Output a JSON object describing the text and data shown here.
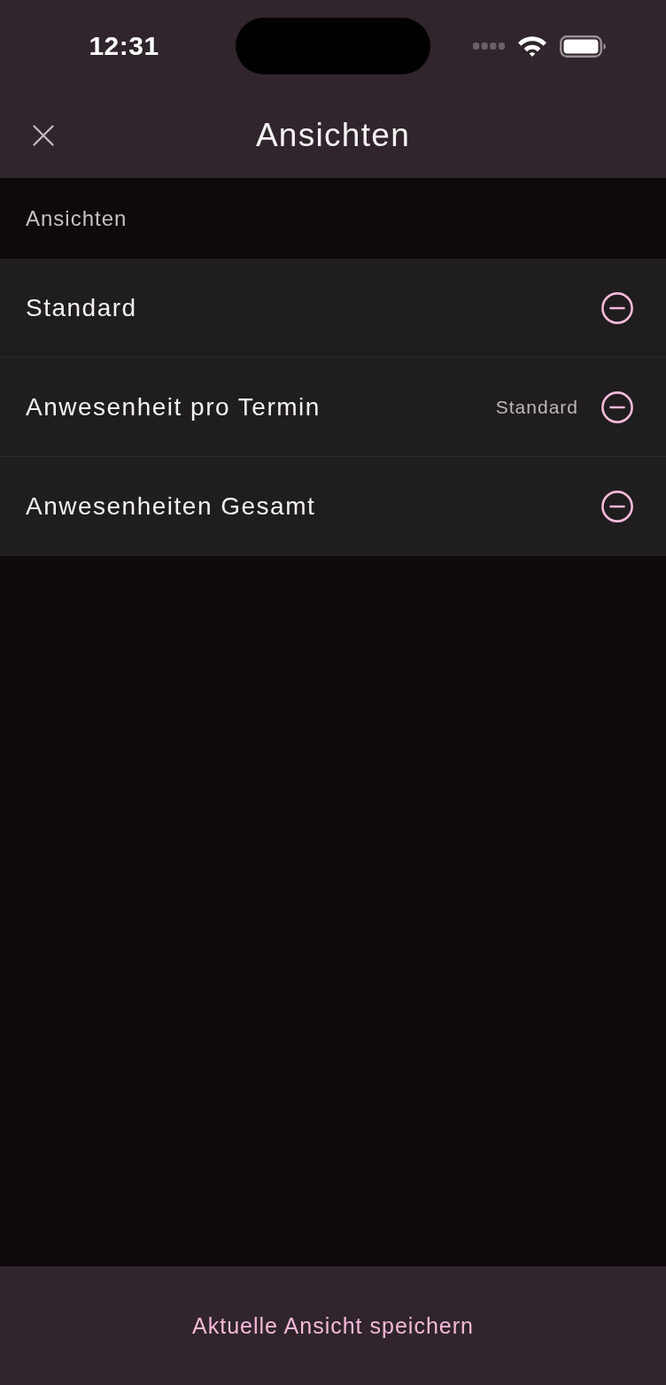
{
  "status_bar": {
    "time": "12:31"
  },
  "header": {
    "title": "Ansichten"
  },
  "section": {
    "label": "Ansichten"
  },
  "views": [
    {
      "name": "Standard"
    },
    {
      "name": "Anwesenheit pro Termin",
      "badge": "Standard"
    },
    {
      "name": "Anwesenheiten Gesamt"
    }
  ],
  "footer": {
    "button": "Aktuelle Ansicht speichern"
  }
}
